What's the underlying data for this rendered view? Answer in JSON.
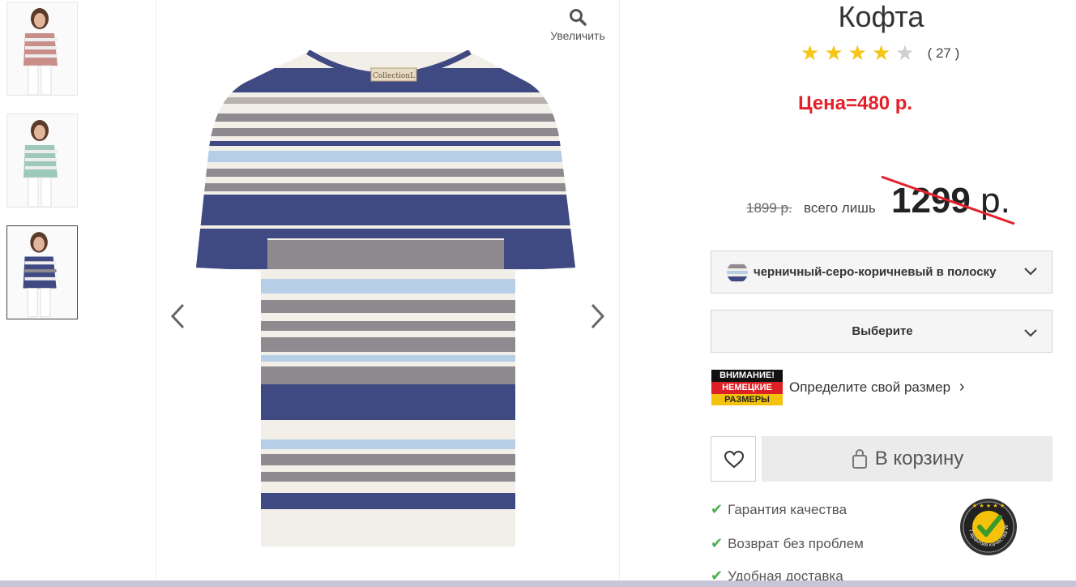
{
  "product": {
    "title": "Кофта",
    "rating": 4,
    "rating_max": 5,
    "reviews": "( 27 )",
    "note": "Цена=480 р.",
    "old_price": "1899 р.",
    "only_label": "всего лишь",
    "price_number": "1299",
    "price_currency": " р."
  },
  "gallery": {
    "zoom_label": "Увеличить",
    "prev": "‹",
    "next": "›"
  },
  "color_select": {
    "value": "черничный-серо-коричневый в полоску"
  },
  "size_select": {
    "value": "Выберите"
  },
  "size_warning": {
    "line1": "ВНИМАНИЕ!",
    "line2": "НЕМЕЦКИЕ",
    "line3": "РАЗМЕРЫ"
  },
  "size_link": {
    "label": "Определите свой размер",
    "chevron": "›"
  },
  "cart_button": {
    "label": "В корзину"
  },
  "features": [
    "Гарантия качества",
    "Возврат без проблем",
    "Удобная доставка"
  ],
  "badge": {
    "text": "Гарантия качества WITT"
  },
  "colors": {
    "navy": "#3f4a82",
    "grey": "#8f8a90",
    "light_blue": "#b7cfe6",
    "cream": "#f2efe9",
    "star_on": "#f5c518",
    "star_off": "#cfcfcf",
    "accent_red": "#e5202a"
  }
}
